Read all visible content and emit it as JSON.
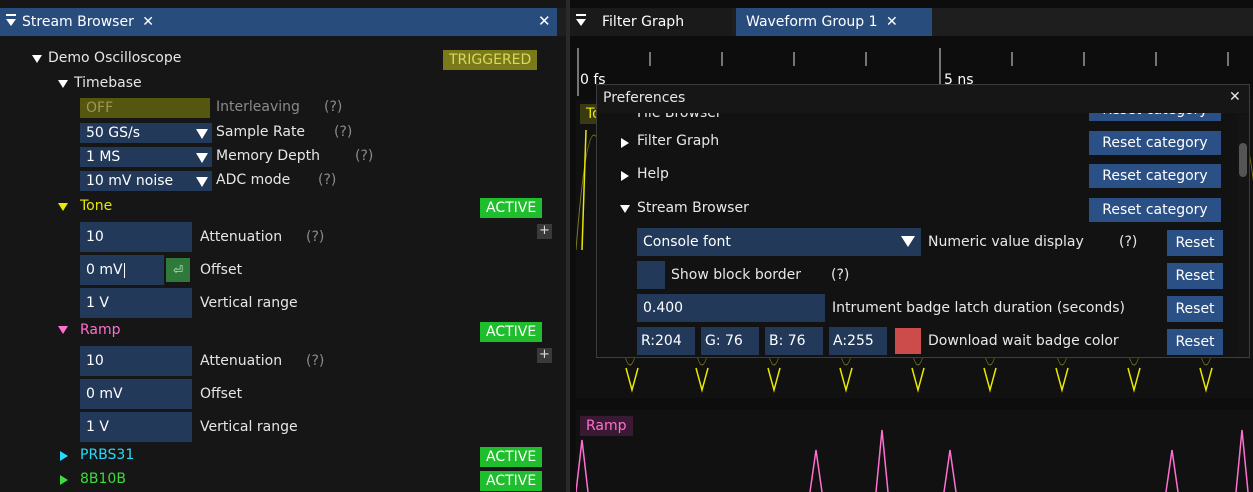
{
  "left_panel": {
    "tab_title": "Stream Browser",
    "tab_close": "✕",
    "panel_close": "✕",
    "instrument": {
      "name": "Demo Oscilloscope",
      "badge": "TRIGGERED",
      "timebase": {
        "label": "Timebase",
        "interleaving_value": "OFF",
        "interleaving_label": "Interleaving",
        "help": "(?)",
        "sample_rate_value": "50 GS/s",
        "sample_rate_label": "Sample Rate",
        "memory_depth_value": "1 MS",
        "memory_depth_label": "Memory Depth",
        "adc_mode_value": "10 mV noise",
        "adc_mode_label": "ADC mode"
      },
      "channels": [
        {
          "name": "Tone",
          "color": "#e8e800",
          "badge": "ACTIVE",
          "attenuation_value": "10",
          "attenuation_label": "Attenuation",
          "offset_value": "0 mV",
          "offset_label": "Offset",
          "range_value": "1 V",
          "range_label": "Vertical range"
        },
        {
          "name": "Ramp",
          "color": "#ff6fd0",
          "badge": "ACTIVE",
          "attenuation_value": "10",
          "attenuation_label": "Attenuation",
          "offset_value": "0 mV",
          "offset_label": "Offset",
          "range_value": "1 V",
          "range_label": "Vertical range"
        },
        {
          "name": "PRBS31",
          "color": "#29d8ff",
          "badge": "ACTIVE"
        },
        {
          "name": "8B10B",
          "color": "#3cdc3c",
          "badge": "ACTIVE"
        }
      ]
    }
  },
  "right_panel": {
    "tabs": [
      {
        "label": "Filter Graph"
      },
      {
        "label": "Waveform Group 1",
        "close": "✕"
      }
    ],
    "timeline": {
      "start_label": "0 fs",
      "mid_label": "5 ns"
    },
    "waveforms": [
      {
        "name": "Tone",
        "color": "#e8e800"
      },
      {
        "name": "Ramp",
        "color": "#ff6fd0"
      }
    ]
  },
  "preferences": {
    "title": "Preferences",
    "close": "✕",
    "clipped_category": "File Browser",
    "reset_category_label": "Reset category",
    "categories": [
      "Filter Graph",
      "Help",
      "Stream Browser"
    ],
    "stream_browser_settings": {
      "console_font_value": "Console font",
      "numeric_display_label": "Numeric value display",
      "help": "(?)",
      "show_block_border_label": "Show block border",
      "latch_value": "0.400",
      "latch_label": "Intrument badge latch duration (seconds)",
      "color_r": "R:204",
      "color_g": "G: 76",
      "color_b": "B: 76",
      "color_a": "A:255",
      "swatch_color": "#cc4c4c",
      "wait_badge_label": "Download wait badge color",
      "reset_label": "Reset"
    }
  }
}
